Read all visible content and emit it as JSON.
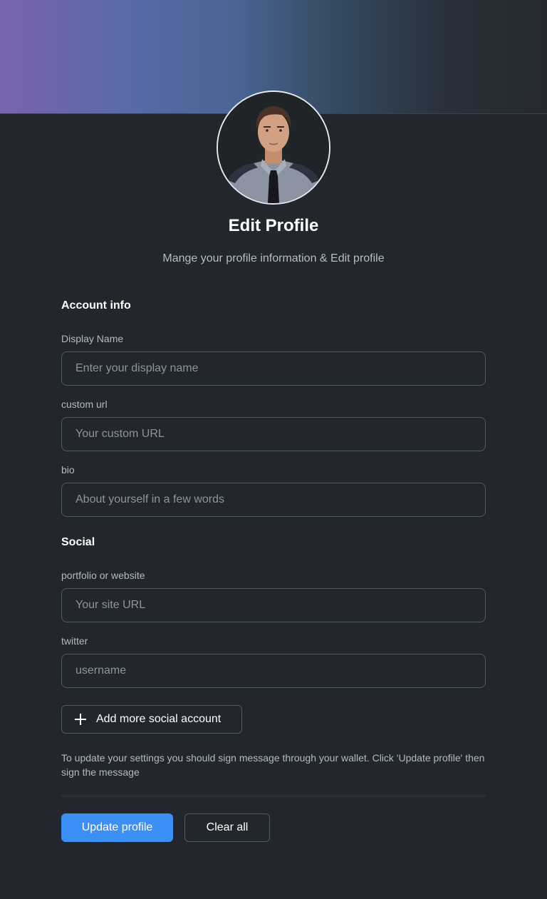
{
  "header": {
    "title": "Edit Profile",
    "subtitle": "Mange your profile information & Edit profile"
  },
  "account_info": {
    "heading": "Account info",
    "display_name": {
      "label": "Display Name",
      "value": "",
      "placeholder": "Enter your display name"
    },
    "custom_url": {
      "label": "custom url",
      "value": "",
      "placeholder": "Your custom URL"
    },
    "bio": {
      "label": "bio",
      "value": "",
      "placeholder": "About yourself in a few words"
    }
  },
  "social": {
    "heading": "Social",
    "portfolio": {
      "label": "portfolio or website",
      "value": "",
      "placeholder": "Your site URL"
    },
    "twitter": {
      "label": "twitter",
      "value": "",
      "placeholder": "username"
    },
    "add_more_label": "Add more social account"
  },
  "notice": "To update your settings you should sign message through your wallet. Click 'Update profile' then sign the message",
  "actions": {
    "update_label": "Update profile",
    "clear_label": "Clear all"
  },
  "colors": {
    "background": "#22272e",
    "accent": "#3b8ff5",
    "border": "#525a65"
  },
  "icons": {
    "add": "plus-icon"
  }
}
